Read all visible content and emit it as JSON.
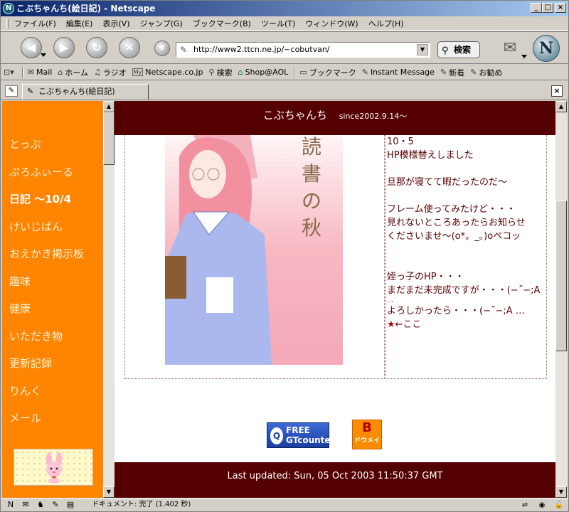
{
  "window": {
    "title": "こぶちゃんち(絵日記) - Netscape"
  },
  "menu": [
    "ファイル(F)",
    "編集(E)",
    "表示(V)",
    "ジャンプ(G)",
    "ブックマーク(B)",
    "ツール(T)",
    "ウィンドウ(W)",
    "ヘルプ(H)"
  ],
  "navbar": {
    "url": "http://www2.ttcn.ne.jp/~cobutvan/",
    "search_label": "検索",
    "logo_letter": "N"
  },
  "bookmarks": [
    {
      "icon": "mail-icon",
      "glyph": "✉",
      "label": "Mail"
    },
    {
      "icon": "home-icon",
      "glyph": "⌂",
      "label": "ホーム"
    },
    {
      "icon": "radio-icon",
      "glyph": "♫",
      "label": "ラジオ"
    },
    {
      "icon": "my-netscape-icon",
      "glyph": "My",
      "label": "Netscape.co.jp"
    },
    {
      "icon": "search-icon",
      "glyph": "⚲",
      "label": "検索"
    },
    {
      "icon": "shop-icon",
      "glyph": "⌂",
      "label": "Shop@AOL"
    },
    {
      "icon": "folder-icon",
      "glyph": "▭",
      "label": "ブックマーク"
    },
    {
      "icon": "bookmark-link-icon",
      "glyph": "✎",
      "label": "Instant Message"
    },
    {
      "icon": "bookmark-link-icon",
      "glyph": "✎",
      "label": "新着"
    },
    {
      "icon": "bookmark-link-icon",
      "glyph": "✎",
      "label": "お勧め"
    }
  ],
  "tab": {
    "label": "こぶちゃんち(絵日記)"
  },
  "left_nav": [
    {
      "label": "とっぷ",
      "current": false
    },
    {
      "label": "ぷろふぃーる",
      "current": false
    },
    {
      "label": "日記 〜10/4",
      "current": true
    },
    {
      "label": "けいじばん",
      "current": false
    },
    {
      "label": "おえかき掲示板",
      "current": false
    },
    {
      "label": "趣味",
      "current": false
    },
    {
      "label": "健康",
      "current": false
    },
    {
      "label": "いただき物",
      "current": false
    },
    {
      "label": "更新記録",
      "current": false
    },
    {
      "label": "りんく",
      "current": false
    },
    {
      "label": "メール",
      "current": false
    }
  ],
  "site": {
    "name": "こぶちゃんち",
    "since": "since2002.9.14〜",
    "art_caption": "読書の秋",
    "diary": [
      "10・5",
      "HP模様替えしました",
      "",
      "旦那が寝てて暇だったのだ〜",
      "",
      "フレーム使ってみたけど・・・",
      "見れないところあったらお知らせ",
      "くださいませ〜(o*。_。)oペコッ",
      "",
      "",
      "姪っ子のHP・・・",
      "まだまだ未完成ですが・・・(−˝−;A",
      "…",
      "よろしかったら・・・(−˝−;A …"
    ],
    "star_link": "←ここ",
    "counter_badge": {
      "line1": "FREE",
      "line2": "GTcounter"
    },
    "b_badge": {
      "big": "B",
      "small": "ドウメイ"
    },
    "footer": "Last updated: Sun, 05 Oct 2003 11:50:37 GMT"
  },
  "status": {
    "text": "ドキュメント: 完了 (1.402 秒)"
  },
  "colors": {
    "nav_orange": "#ff8400",
    "header_maroon": "#550000",
    "diary_text": "#5a0000"
  }
}
